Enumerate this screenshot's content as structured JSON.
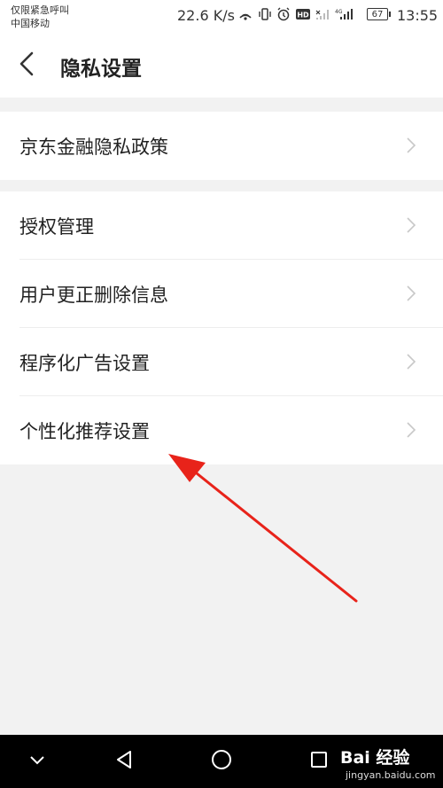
{
  "status_bar": {
    "carrier_line1": "仅限紧急呼叫",
    "carrier_line2": "中国移动",
    "net_speed": "22.6 K/s",
    "battery": "67",
    "time": "13:55",
    "icons": [
      "hotspot-icon",
      "vibrate-icon",
      "alarm-icon",
      "hd-icon",
      "signal-icon",
      "signal-4g-icon"
    ]
  },
  "header": {
    "back_icon": "back-arrow-icon",
    "title": "隐私设置"
  },
  "sections": [
    {
      "items": [
        {
          "label": "京东金融隐私政策"
        }
      ]
    },
    {
      "items": [
        {
          "label": "授权管理"
        },
        {
          "label": "用户更正删除信息"
        },
        {
          "label": "程序化广告设置"
        },
        {
          "label": "个性化推荐设置"
        }
      ]
    }
  ],
  "nav_bar": {
    "buttons": [
      "collapse-icon",
      "back-triangle-icon",
      "home-circle-icon",
      "recents-square-icon"
    ]
  },
  "watermark": {
    "line1": "Bai 经验",
    "line2": "jingyan.baidu.com"
  },
  "colors": {
    "background": "#f2f2f2",
    "annotation_arrow": "#e8231a",
    "nav_bar": "#000000"
  }
}
